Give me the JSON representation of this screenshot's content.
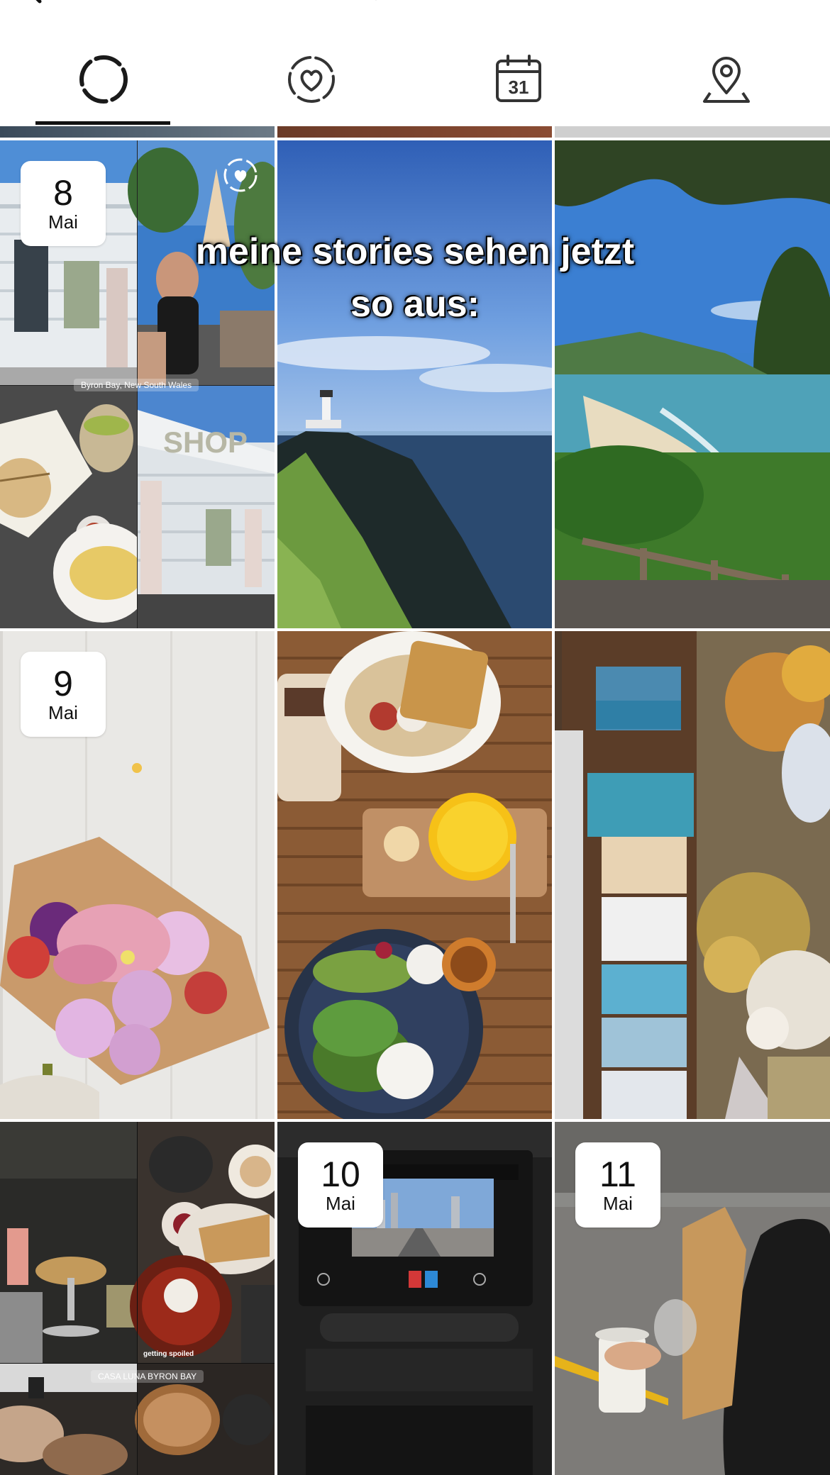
{
  "tabs": [
    {
      "icon": "stories-ring-icon",
      "active": true
    },
    {
      "icon": "heart-highlight-icon",
      "active": false
    },
    {
      "icon": "calendar-icon",
      "active": false,
      "day_label": "31"
    },
    {
      "icon": "location-pin-icon",
      "active": false
    }
  ],
  "days": [
    {
      "day": "8",
      "month": "Mai"
    },
    {
      "day": "9",
      "month": "Mai"
    },
    {
      "day": "10",
      "month": "Mai"
    },
    {
      "day": "11",
      "month": "Mai"
    }
  ],
  "overlay": {
    "line1": "meine stories sehen jetzt",
    "line2": "so aus:"
  },
  "locations": {
    "byron": "Byron Bay, New South Wales",
    "casa": "CASA LUNA BYRON BAY"
  },
  "stickers": {
    "spoiled": "getting spoiled"
  },
  "colors": {
    "tab_active": "#111111",
    "badge_bg": "#ffffff"
  }
}
